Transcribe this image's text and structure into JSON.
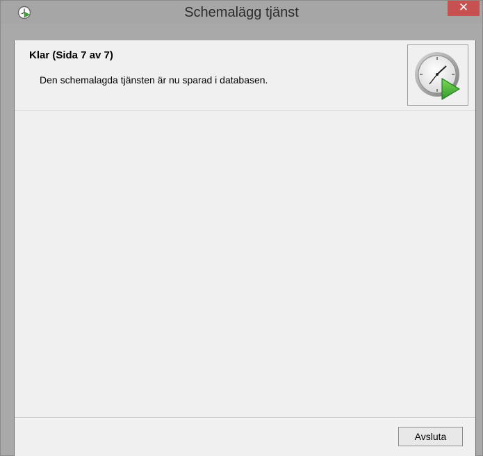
{
  "window": {
    "title": "Schemalägg tjänst",
    "close_glyph": "✕"
  },
  "header": {
    "title": "Klar (Sida 7 av 7)",
    "description": "Den schemalagda tjänsten är nu sparad i databasen.",
    "image_icon": "clock-play-icon"
  },
  "footer": {
    "finish_label": "Avsluta"
  },
  "colors": {
    "close_button": "#c75050",
    "titlebar": "#a6a6a6",
    "play_green": "#3aa535"
  }
}
